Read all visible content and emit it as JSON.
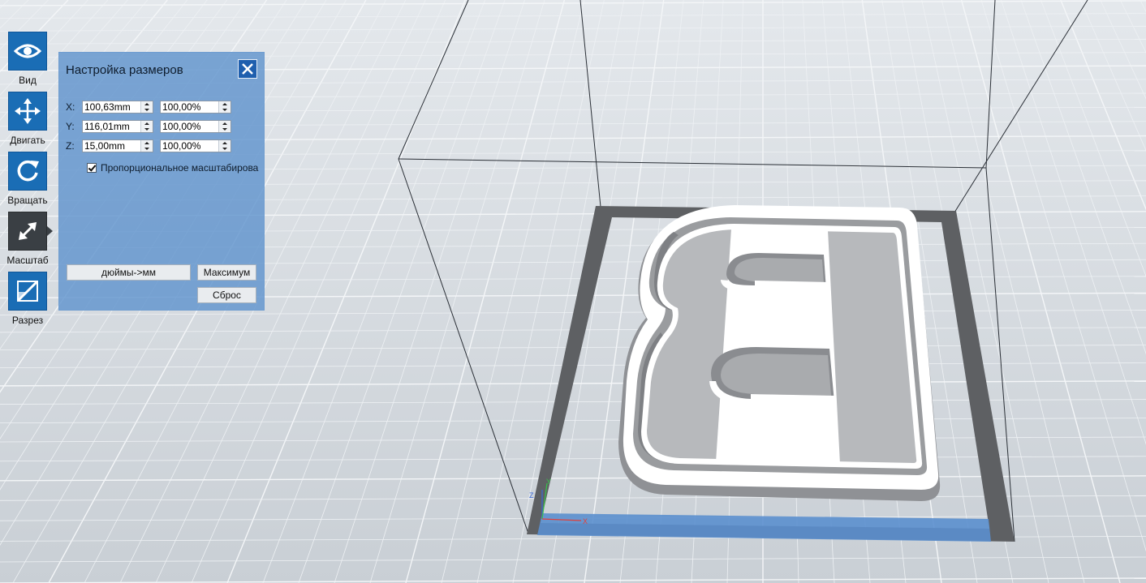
{
  "toolbar": {
    "items": [
      {
        "label": "Вид",
        "icon": "eye-icon"
      },
      {
        "label": "Двигать",
        "icon": "move-icon"
      },
      {
        "label": "Вращать",
        "icon": "rotate-icon"
      },
      {
        "label": "Масштаб",
        "icon": "scale-icon",
        "active": true
      },
      {
        "label": "Разрез",
        "icon": "cut-icon"
      }
    ]
  },
  "panel": {
    "title": "Настройка размеров",
    "rows": [
      {
        "axis": "X:",
        "size": "100,63mm",
        "percent": "100,00%"
      },
      {
        "axis": "Y:",
        "size": "116,01mm",
        "percent": "100,00%"
      },
      {
        "axis": "Z:",
        "size": "15,00mm",
        "percent": "100,00%"
      }
    ],
    "proportional_label": "Пропорциональное масштабирова",
    "proportional_checked": true,
    "inch_button": "дюймы->мм",
    "max_button": "Максимум",
    "reset_button": "Сброс"
  },
  "axes": {
    "x": "X",
    "y": "Y",
    "z": "Z"
  },
  "colors": {
    "accent": "#1a6db5",
    "panel": "#6094cd",
    "active_tool": "#3a3f44",
    "bed_frame": "#5e6063",
    "model": "#ffffff",
    "x_axis": "#e0403a",
    "y_axis": "#38c24a",
    "z_axis": "#3a68d8"
  }
}
